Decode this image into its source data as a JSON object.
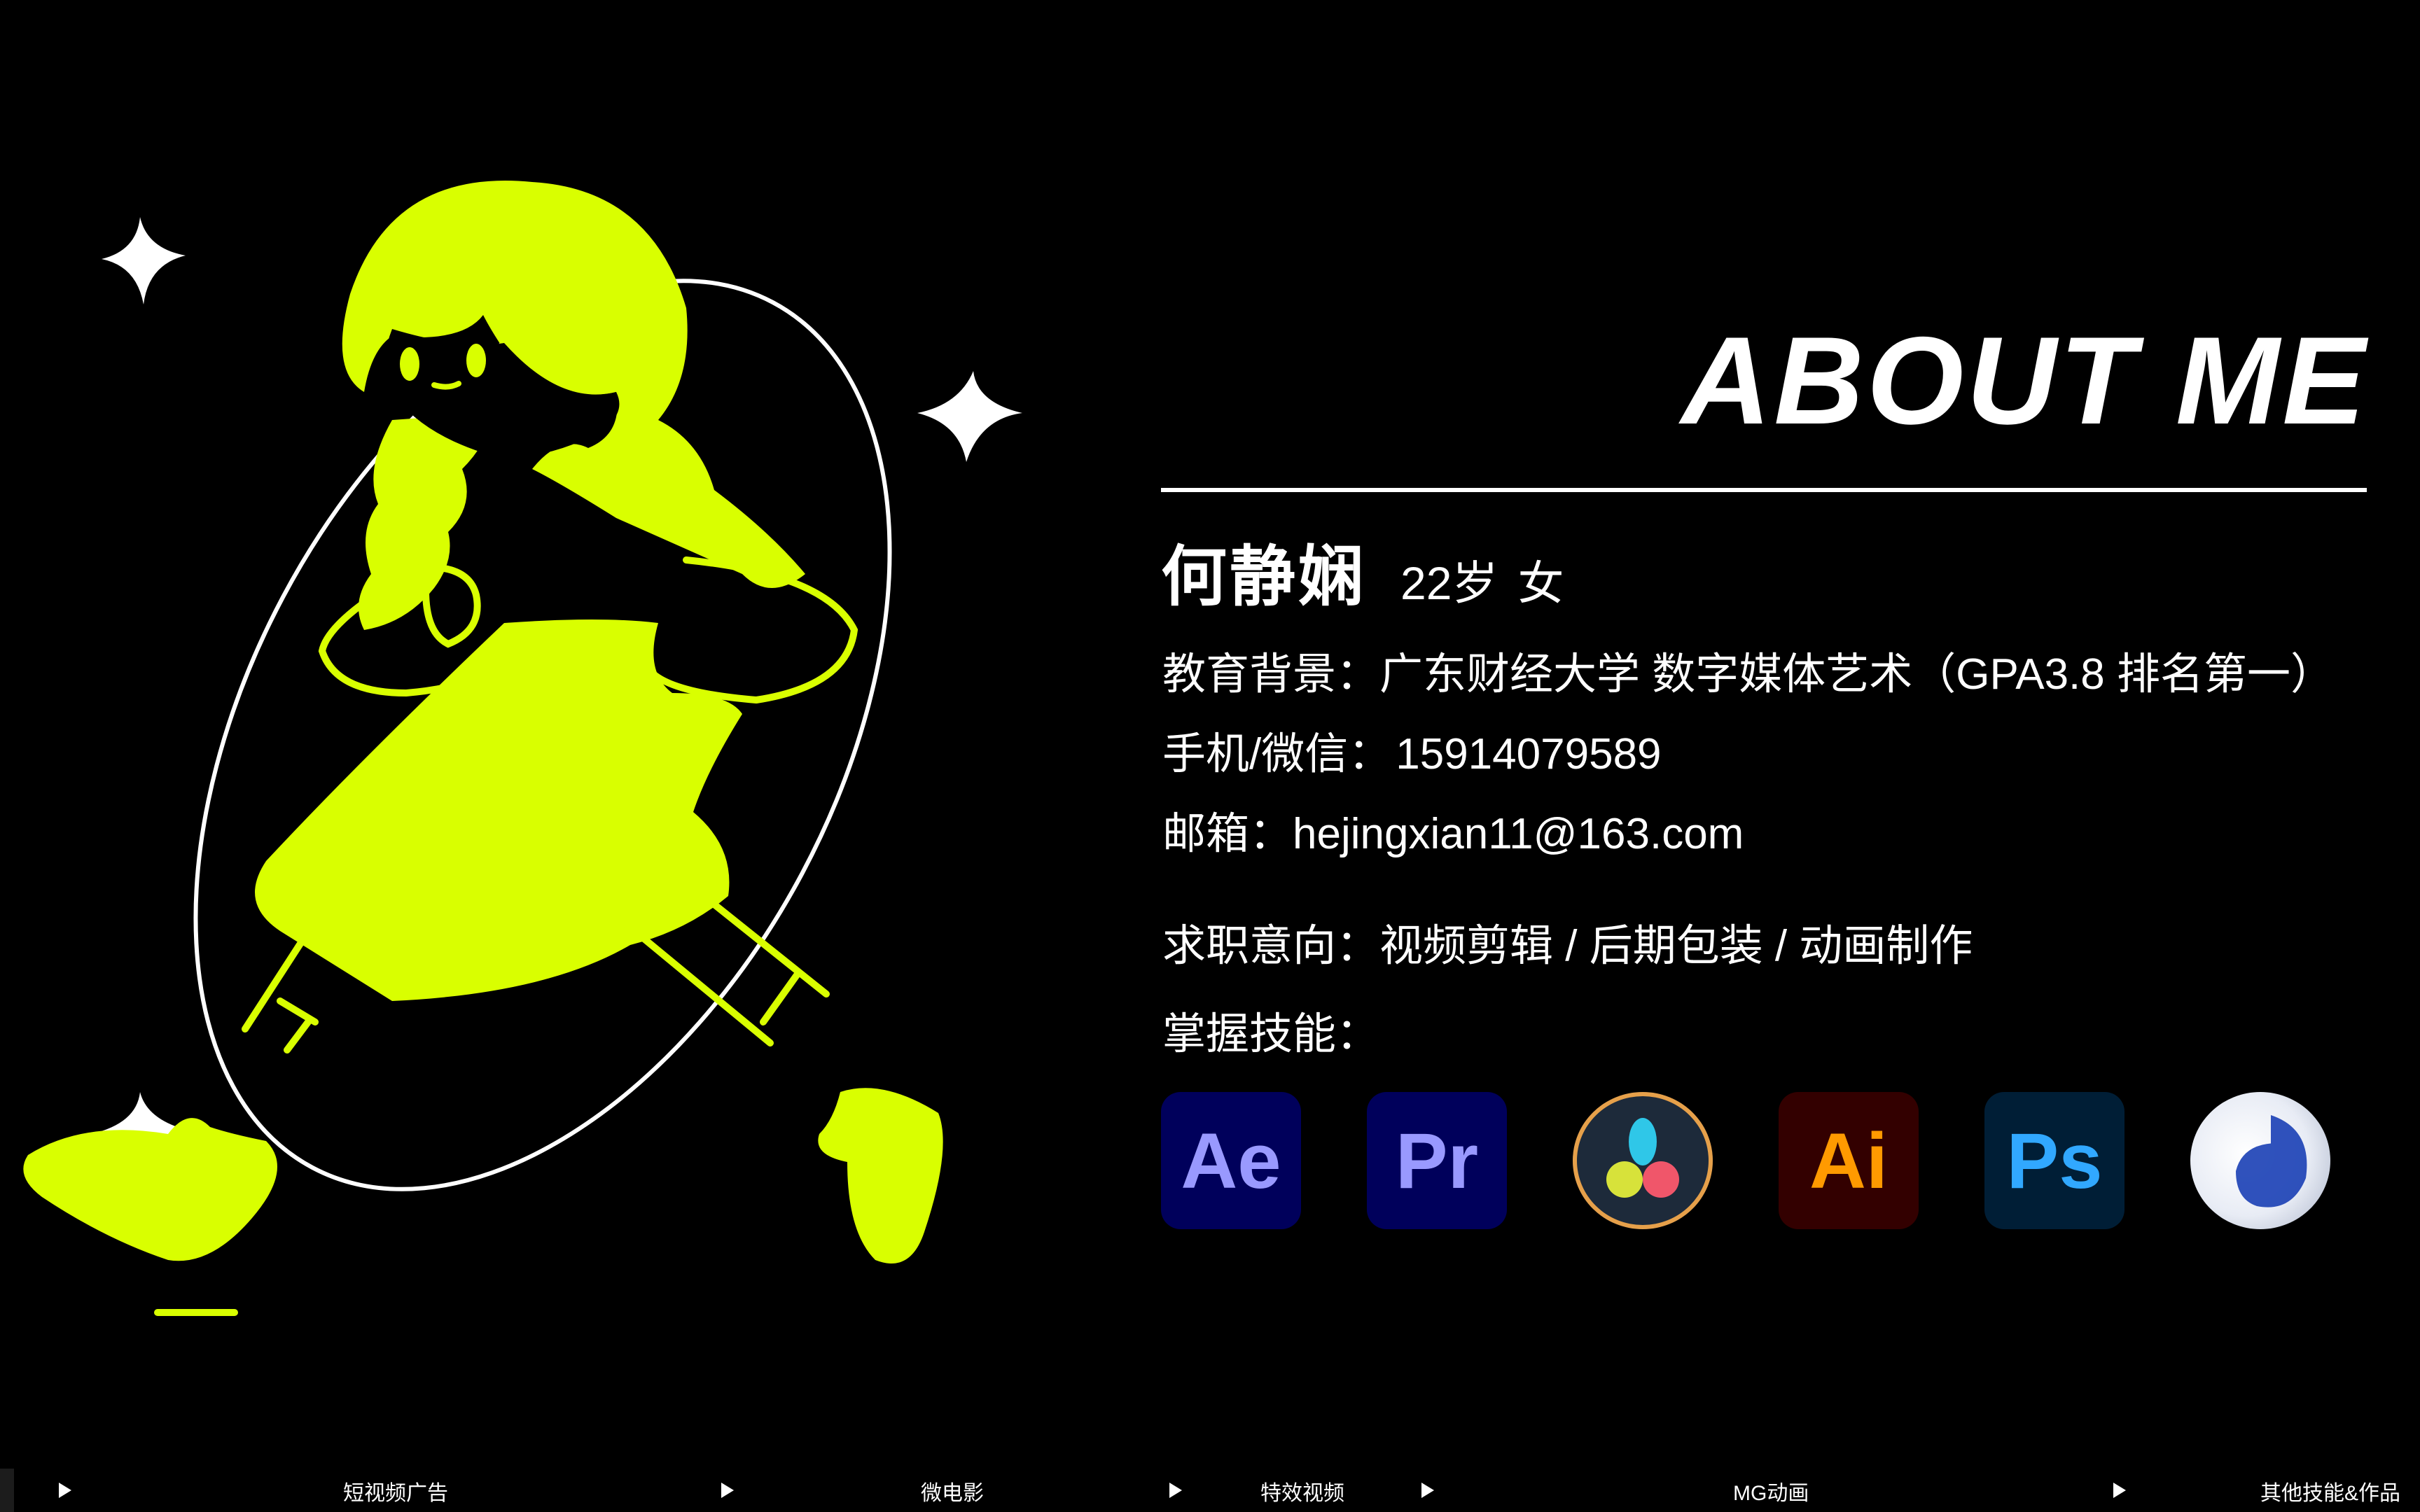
{
  "header": {
    "title": "ABOUT ME"
  },
  "profile": {
    "name": "何静娴",
    "age": "22岁",
    "gender": "女",
    "education_label": "教育背景：",
    "education_value": "广东财经大学 数字媒体艺术（GPA3.8 排名第一）",
    "phone_label": "手机/微信：",
    "phone_value": "15914079589",
    "email_label": "邮箱：",
    "email_value": "hejingxian11@163.com",
    "objective_label": "求职意向：",
    "objective_value": "视频剪辑 / 后期包装 / 动画制作",
    "skills_label": "掌握技能："
  },
  "skills": [
    {
      "name": "after-effects",
      "label": "Ae",
      "bg": "#00005b",
      "fg": "#9999ff"
    },
    {
      "name": "premiere-pro",
      "label": "Pr",
      "bg": "#00005b",
      "fg": "#9999ff"
    },
    {
      "name": "davinci-resolve",
      "label": "",
      "bg": "#1d2a3a",
      "fg": "#ffffff"
    },
    {
      "name": "illustrator",
      "label": "Ai",
      "bg": "#330000",
      "fg": "#ff9a00"
    },
    {
      "name": "photoshop",
      "label": "Ps",
      "bg": "#001e36",
      "fg": "#31a8ff"
    },
    {
      "name": "cinema-4d",
      "label": "",
      "bg": "#ffffff",
      "fg": "#1a3fb5"
    }
  ],
  "colors": {
    "accent": "#d9ff00",
    "background": "#000000",
    "text": "#ffffff"
  },
  "nav": {
    "items": [
      {
        "label": "短视频广告"
      },
      {
        "label": "微电影"
      },
      {
        "label": "特效视频"
      },
      {
        "label": "MG动画"
      },
      {
        "label": "其他技能&作品"
      }
    ]
  }
}
